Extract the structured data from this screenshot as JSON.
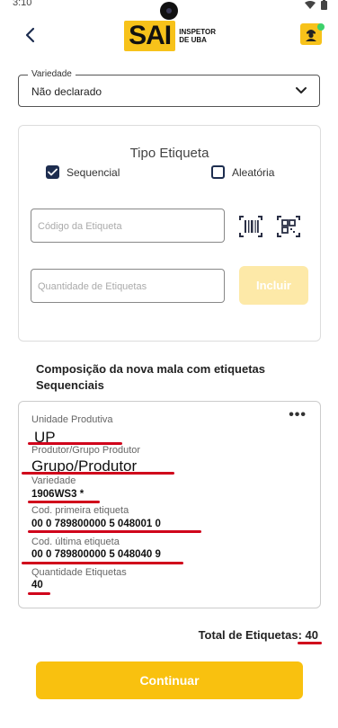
{
  "status_bar": {
    "time": "3:10"
  },
  "header": {
    "logo_letters": "SAI",
    "logo_subtitle_line1": "INSPETOR",
    "logo_subtitle_line2": "DE UBA"
  },
  "variety_select": {
    "label": "Variedade",
    "value": "Não declarado"
  },
  "tag_card": {
    "title": "Tipo Etiqueta",
    "option_sequential": "Sequencial",
    "option_random": "Aleatória",
    "sequential_checked": true,
    "random_checked": false,
    "code_placeholder": "Código da Etiqueta",
    "quantity_placeholder": "Quantidade de Etiquetas",
    "include_button": "Incluir"
  },
  "composition": {
    "title": "Composição da nova mala com etiquetas Sequenciais",
    "fields": [
      {
        "label": "Unidade Produtiva",
        "value": "UP"
      },
      {
        "label": "Produtor/Grupo Produtor",
        "value": "Grupo/Produtor"
      },
      {
        "label": "Variedade",
        "value": "1906WS3 *"
      },
      {
        "label": "Cod. primeira etiqueta",
        "value": "00 0 789800000 5 048001 0"
      },
      {
        "label": "Cod. última etiqueta",
        "value": "00 0 789800000 5 048040 9"
      },
      {
        "label": "Quantidade Etiquetas",
        "value": "40"
      }
    ],
    "menu_glyph": "•••"
  },
  "total": {
    "label": "Total de Etiquetas:",
    "value": "40"
  },
  "continue_button": "Continuar",
  "colors": {
    "accent": "#f9c10f",
    "checkbox": "#1d2d4f",
    "annotation_red": "#d0021b"
  }
}
